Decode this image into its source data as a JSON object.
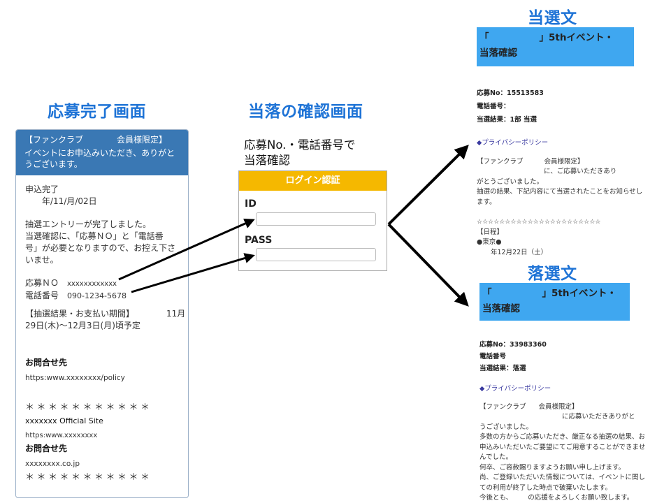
{
  "titles": {
    "complete": "応募完了画面",
    "check": "当落の確認画面",
    "win": "当選文",
    "lose": "落選文"
  },
  "phone": {
    "header_line1_a": "【ファンクラブ",
    "header_line1_b": "会員様限定】",
    "header_line2": "イベントにお申込みいただき、ありがと",
    "header_line3": "うございます。",
    "status": "申込完了",
    "date": "年/11/月/02日",
    "msg1": "抽選エントリーが完了しました。",
    "msg2": "当選確認に、「応募ＮＯ」と「電話番",
    "msg3": "号」が必要となりますので、お控え下さ",
    "msg4": "いませ。",
    "no_label": "応募ＮＯ",
    "no_value": "xxxxxxxxxxxx",
    "tel_label": "電話番号",
    "tel_value": "090-1234-5678",
    "period_a": "【抽選結果・お支払い期間】",
    "period_b": "11月",
    "period_c": "29日(木)〜12月3日(月)頃予定",
    "contact_label": "お問合せ先",
    "contact_url": "https:www.xxxxxxxx/policy",
    "stars1": "＊＊＊＊＊＊＊＊＊＊＊",
    "site": "xxxxxxx Official Site",
    "site_url": "https:www.xxxxxxxx",
    "contact_label2": "お問合せ先",
    "contact_mail": "xxxxxxxx.co.jp",
    "stars2": "＊＊＊＊＊＊＊＊＊＊＊"
  },
  "login": {
    "caption1": "応募No.・電話番号で",
    "caption2": "当落確認",
    "header": "ログイン認証",
    "id_label": "ID",
    "pass_label": "PASS"
  },
  "win": {
    "banner1a": "「",
    "banner1b": "」5thイベント・",
    "banner2": "当落確認",
    "no": "応募No：15513583",
    "tel": "電話番号：",
    "result": "当選結果：1部 当選",
    "policy": "◆プライバシーポリシー",
    "l1a": "【ファンクラブ",
    "l1b": "会員様限定】",
    "l2": "に、ご応募いただきあり",
    "l3": "がとうございました。",
    "l4": "抽選の結果、下記内容にて当選されたことをお知らせし",
    "l5": "ます。",
    "stars": "☆☆☆☆☆☆☆☆☆☆☆☆☆☆☆☆☆☆☆☆☆☆",
    "l6": "【日程】",
    "l7": "●東京●",
    "l8": "年12月22日（土）"
  },
  "lose": {
    "banner1a": "「",
    "banner1b": "」5thイベント・",
    "banner2": "当落確認",
    "no": "応募No：33983360",
    "tel": "電話番号",
    "result": "当選結果：落選",
    "policy": "◆プライバシーポリシー",
    "l1a": "【ファンクラブ",
    "l1b": "会員様限定】",
    "l2": "に応募いただきありがと",
    "l3": "うございました。",
    "l4": "多数の方からご応募いただき、厳正なる抽選の結果、お",
    "l5": "申込みいただいたご要望にてご用意することができませ",
    "l6": "んでした。",
    "l7": "何卒、ご容赦賜りますようお願い申し上げます。",
    "l8": "尚、ご登録いただいた情報については、イベントに関し",
    "l9": "ての利用が終了した時点で破棄いたします。",
    "l10a": "今後とも、",
    "l10b": "の応援をよろしくお願い致します。"
  }
}
